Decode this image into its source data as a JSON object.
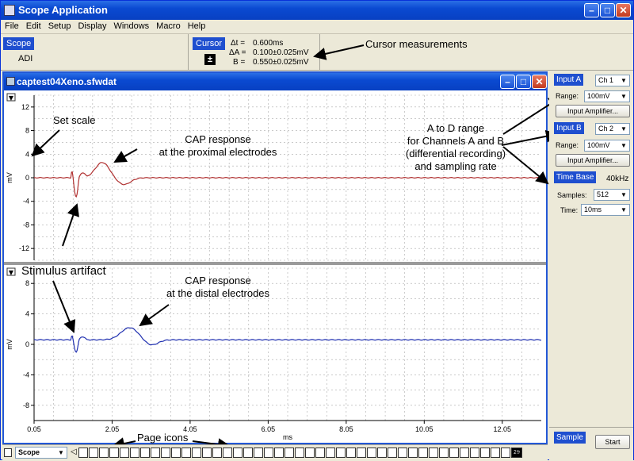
{
  "window": {
    "title": "Scope Application"
  },
  "menu": [
    "File",
    "Edit",
    "Setup",
    "Display",
    "Windows",
    "Macro",
    "Help"
  ],
  "scope_panel": {
    "label": "Scope",
    "device": "ADI"
  },
  "cursor_panel": {
    "label": "Cursor",
    "rows": [
      {
        "name": "Δt =",
        "value": "0.600ms"
      },
      {
        "name": "ΔA =",
        "value": "0.100±0.025mV"
      },
      {
        "name": "B =",
        "value": "0.550±0.025mV"
      }
    ]
  },
  "document": {
    "title": "captest04Xeno.sfwdat"
  },
  "annotations": {
    "cursor_measurements": "Cursor measurements",
    "set_scale": "Set scale",
    "cap_proximal_line1": "CAP response",
    "cap_proximal_line2": "at the proximal electrodes",
    "ad_range_line1": "A to D range",
    "ad_range_line2": "for Channels A and B",
    "ad_range_line3": "(differential recording)",
    "ad_range_line4": "and sampling rate",
    "stimulus_artifact": "Stimulus artifact",
    "cap_distal_line1": "CAP response",
    "cap_distal_line2": "at the distal electrodes",
    "page_icons": "Page icons"
  },
  "channel_a_plot": {
    "y_ticks": [
      "12",
      "8",
      "4",
      "0",
      "-4",
      "-8",
      "-12"
    ],
    "y_values": [
      12,
      8,
      4,
      0,
      -4,
      -8,
      -12
    ],
    "ylabel": "mV",
    "color": "#b03030"
  },
  "channel_b_plot": {
    "y_ticks": [
      "8",
      "4",
      "0",
      "-4",
      "-8"
    ],
    "y_values": [
      8,
      4,
      0,
      -4,
      -8
    ],
    "ylabel": "mV",
    "color": "#2030b0"
  },
  "x_axis": {
    "ticks": [
      "0.05",
      "2.05",
      "4.05",
      "6.05",
      "8.05",
      "10.05",
      "12.05"
    ],
    "tick_values": [
      0.05,
      2.05,
      4.05,
      6.05,
      8.05,
      10.05,
      12.05
    ],
    "xlabel": "ms",
    "range": [
      0.05,
      13.05
    ]
  },
  "input_a": {
    "label": "Input A",
    "channel": "Ch 1",
    "range_label": "Range:",
    "range": "100mV",
    "amp_button": "Input Amplifier..."
  },
  "input_b": {
    "label": "Input B",
    "channel": "Ch 2",
    "range_label": "Range:",
    "range": "100mV",
    "amp_button": "Input Amplifier..."
  },
  "time_base": {
    "label": "Time Base",
    "rate": "40kHz",
    "samples_label": "Samples:",
    "samples": "512",
    "time_label": "Time:",
    "time": "10ms"
  },
  "sample_panel": {
    "label": "Sample",
    "start_button": "Start"
  },
  "bottom": {
    "view_select": "Scope",
    "current_page": "29"
  }
}
